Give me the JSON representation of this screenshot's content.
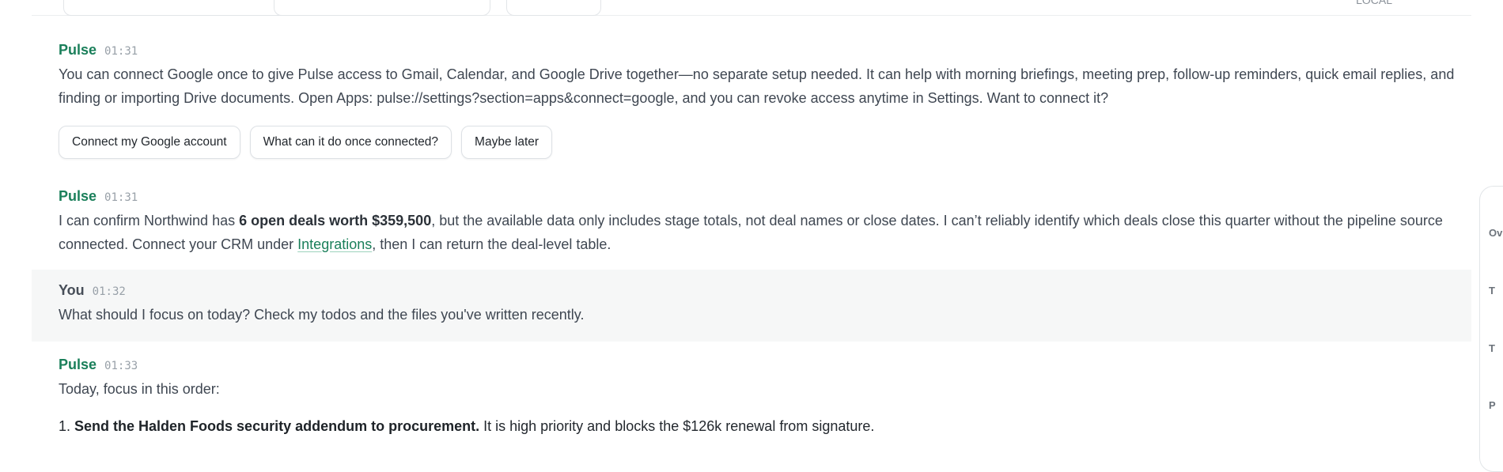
{
  "top_right_text": "LOCAL",
  "messages": [
    {
      "sender": "Pulse",
      "time": "01:31",
      "text": "You can connect Google once to give Pulse access to Gmail, Calendar, and Google Drive together—no separate setup needed. It can help with morning briefings, meeting prep, follow-up reminders, quick email replies, and finding or importing Drive documents. Open Apps: pulse://settings?section=apps&connect=google, and you can revoke access anytime in Settings. Want to connect it?",
      "buttons": [
        "Connect my Google account",
        "What can it do once connected?",
        "Maybe later"
      ]
    },
    {
      "sender": "Pulse",
      "time": "01:31",
      "text_before": "I can confirm Northwind has ",
      "text_bold": "6 open deals worth $359,500",
      "text_middle": ", but the available data only includes stage totals, not deal names or close dates. I can’t reliably identify which deals close this quarter without the pipeline source connected. Connect your CRM under ",
      "link_text": "Integrations",
      "text_after": ", then I can return the deal-level table."
    },
    {
      "sender": "You",
      "time": "01:32",
      "text": "What should I focus on today? Check my todos and the files you've written recently."
    },
    {
      "sender": "Pulse",
      "time": "01:33",
      "intro": "Today, focus in this order:",
      "items": [
        {
          "number": "1.",
          "bold": "Send the Halden Foods security addendum to procurement.",
          "rest": " It is high priority and blocks the $126k renewal from signature."
        }
      ]
    }
  ],
  "right_panel_labels": [
    "Ov",
    "T",
    "T",
    "P"
  ]
}
